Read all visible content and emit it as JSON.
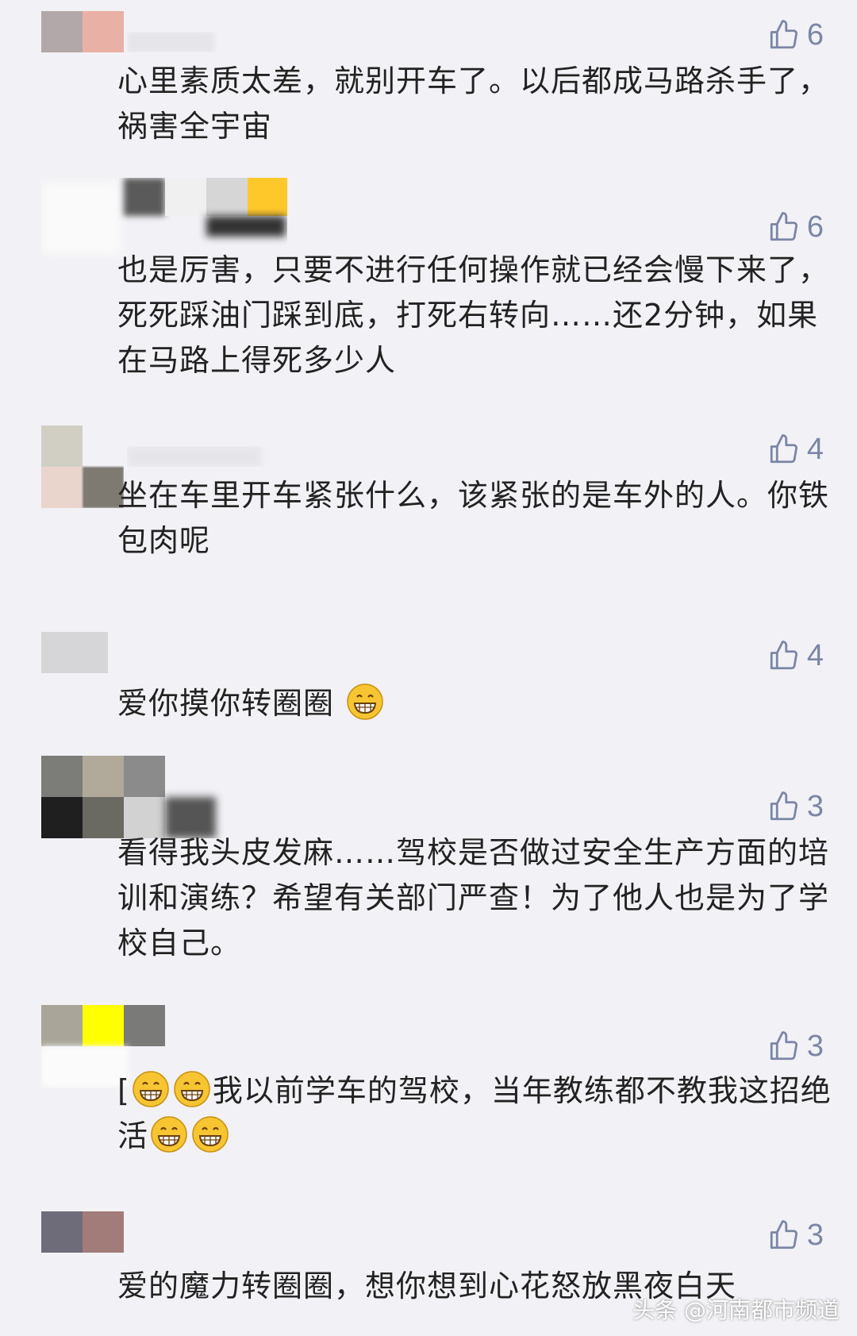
{
  "comments": [
    {
      "text": "心里素质太差，就别开车了。以后都成马路杀手了，祸害全宇宙",
      "likes": "6",
      "avatar_colors": [
        "#b3a8a9",
        "#e9b1a5",
        "#f2f2f6",
        "#f2f2f6"
      ]
    },
    {
      "text": "也是厉害，只要不进行任何操作就已经会慢下来了，死死踩油门踩到底，打死右转向……还2分钟，如果在马路上得死多少人",
      "likes": "6",
      "avatar_colors": [
        "#f7f7f7",
        "#f4f4f4",
        "#ffffff",
        "#f8f8f8"
      ]
    },
    {
      "text": "坐在车里开车紧张什么，该紧张的是车外的人。你铁包肉呢",
      "likes": "4",
      "avatar_colors": [
        "#d1cfc4",
        "#f2f2f6",
        "#ead5cc",
        "#7e7a72"
      ]
    },
    {
      "text_before": "爱你摸你转圈圈",
      "text_after": "",
      "likes": "4",
      "avatar_colors": [
        "#d6d6d8",
        "#e6e6e8",
        "#f2f2f6",
        "#f2f2f6"
      ],
      "emoji_after": 1
    },
    {
      "text": "看得我头皮发麻……驾校是否做过安全生产方面的培训和演练？希望有关部门严查！为了他人也是为了学校自己。",
      "likes": "3",
      "avatar_colors": [
        "#7c7c78",
        "#b1a99a",
        "#1f1f1f",
        "#6a6a62"
      ]
    },
    {
      "text_before": "[",
      "text_mid": "我以前学车的驾校，当年教练都不教我这招绝活",
      "likes": "3",
      "avatar_colors": [
        "#a9a699",
        "#ffff00",
        "#fbfbfb",
        "#f7f7f7"
      ]
    },
    {
      "text": "爱的魔力转圈圈，想你想到心花怒放黑夜白天",
      "likes": "3",
      "avatar_colors": [
        "#6f6c7a",
        "#a17c78",
        "#f2f2f6",
        "#f2f2f6"
      ]
    }
  ],
  "watermark": "头条 @河南都市频道",
  "colors": {
    "like": "#7b86a7",
    "background": "#f2f2f6",
    "text": "#222222"
  },
  "icons": {
    "like": "thumbs-up-icon",
    "emoji": "grinning-emoji-icon"
  }
}
